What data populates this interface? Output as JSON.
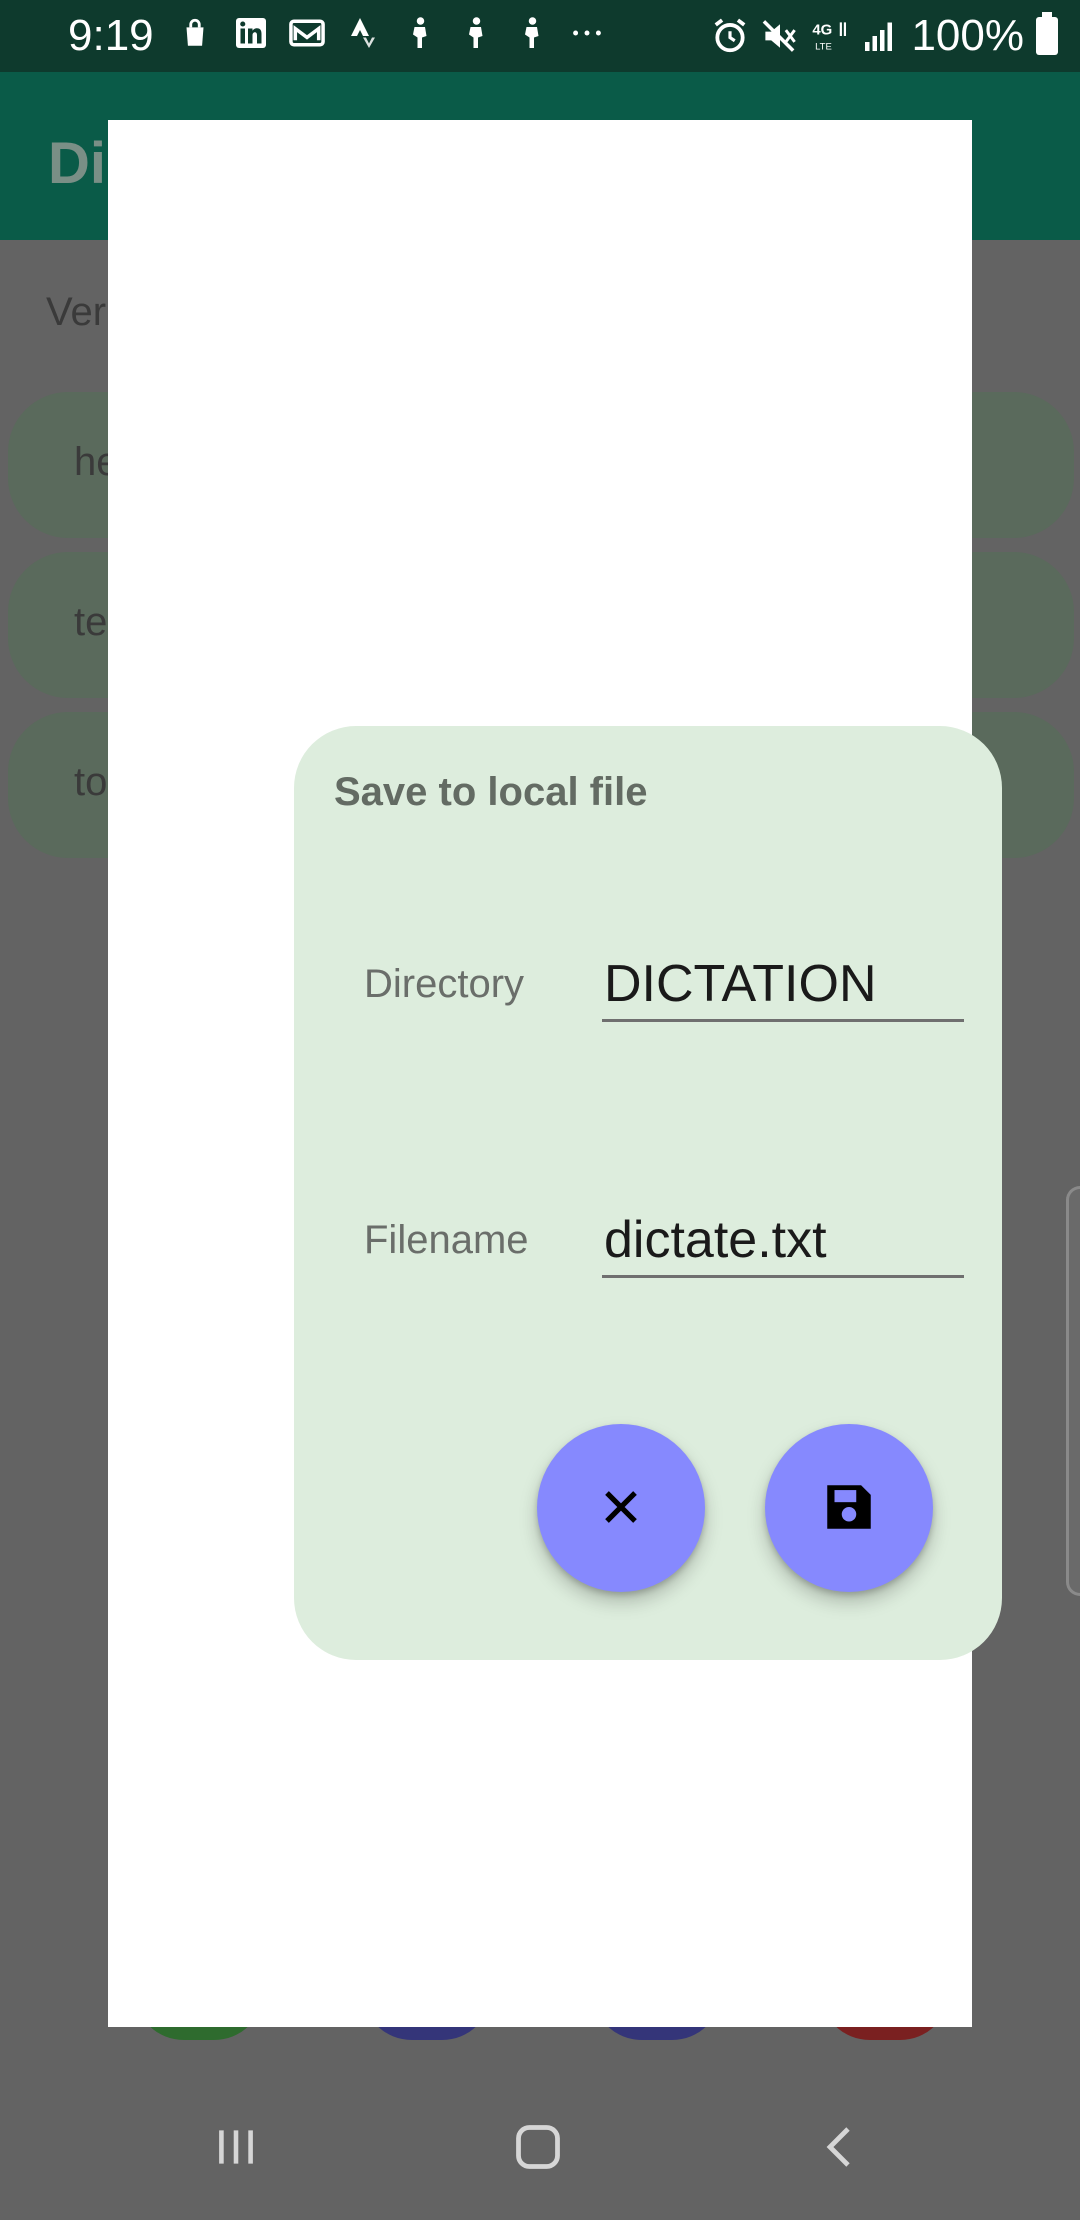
{
  "status_bar": {
    "time": "9:19",
    "battery": "100%",
    "left_icons": [
      "shopping-bag-icon",
      "linkedin-icon",
      "mail-icon",
      "strava-icon",
      "fitness-icon",
      "fitness-icon",
      "fitness-icon",
      "more-icon"
    ],
    "right_icons": [
      "alarm-icon",
      "mute-icon",
      "lte-icon",
      "signal-icon",
      "battery-icon"
    ]
  },
  "background_app": {
    "title": "Dic",
    "label": "Ver",
    "rows": [
      "he",
      "te",
      "to"
    ]
  },
  "dialog": {
    "title": "Save to local file",
    "directory_label": "Directory",
    "directory_value": "DICTATION",
    "filename_label": "Filename",
    "filename_value": "dictate.txt",
    "cancel_icon": "close-icon",
    "save_icon": "floppy-disk-icon"
  },
  "nav_bar": {
    "buttons": [
      "recent-apps-icon",
      "home-icon",
      "back-icon"
    ]
  },
  "colors": {
    "status_bar": "#0e3a2d",
    "app_bar": "#0a5b48",
    "scrim": "#636363",
    "dialog_card": "#ddeddd",
    "fab": "#8689fe"
  }
}
